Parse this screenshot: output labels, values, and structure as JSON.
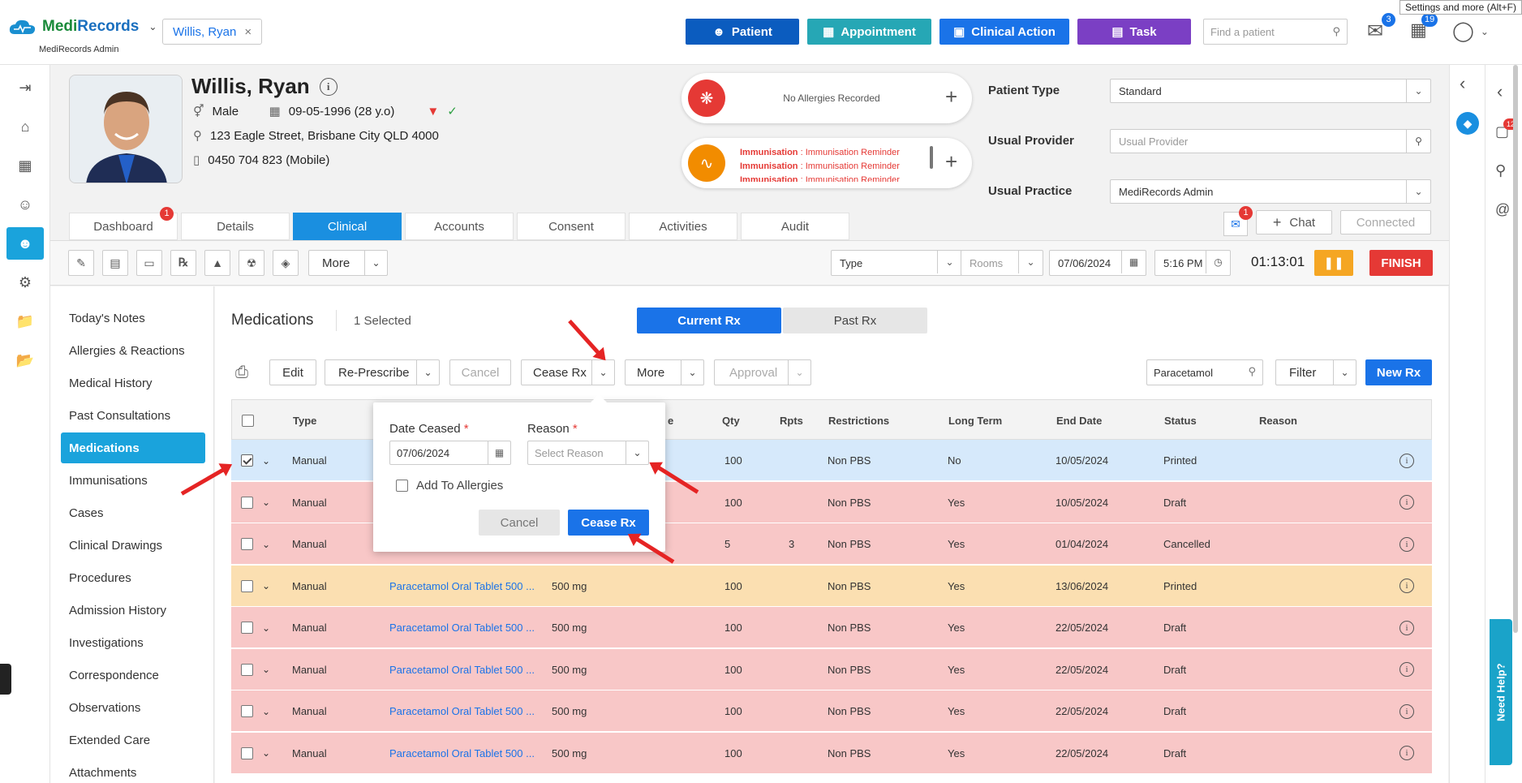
{
  "app": {
    "logo_name_part1": "Medi",
    "logo_name_part2": "Records",
    "logo_sub": "MediRecords Admin",
    "tooltip": "Settings and more (Alt+F)"
  },
  "topbar": {
    "patient_chip": "Willis, Ryan",
    "buttons": {
      "patient": "Patient",
      "appointment": "Appointment",
      "clinical_action": "Clinical Action",
      "task": "Task"
    },
    "find_placeholder": "Find a patient",
    "mail_count": "3",
    "tasks_count": "19",
    "colors": {
      "patient": "#0b5cbf",
      "appointment": "#26a7b5",
      "clinical_action": "#1a73e8",
      "task": "#7b3fc4"
    }
  },
  "patient": {
    "name": "Willis, Ryan",
    "sex": "Male",
    "dob": "09-05-1996 (28 y.o)",
    "address": "123 Eagle Street, Brisbane City QLD 4000",
    "phone": "0450 704 823 (Mobile)"
  },
  "alerts": {
    "allergies": "No Allergies Recorded",
    "immunisations": [
      {
        "label": "Immunisation",
        "value": "Immunisation Reminder"
      },
      {
        "label": "Immunisation",
        "value": "Immunisation Reminder"
      },
      {
        "label": "Immunisation",
        "value": "Immunisation Reminder"
      }
    ]
  },
  "patient_fields": {
    "type_label": "Patient Type",
    "type_value": "Standard",
    "provider_label": "Usual Provider",
    "provider_placeholder": "Usual Provider",
    "practice_label": "Usual Practice",
    "practice_value": "MediRecords Admin"
  },
  "chat": {
    "chat_label": "Chat",
    "connected_label": "Connected",
    "message_badge": "1"
  },
  "tabs": [
    {
      "label": "Dashboard",
      "badge": "1"
    },
    {
      "label": "Details"
    },
    {
      "label": "Clinical"
    },
    {
      "label": "Accounts"
    },
    {
      "label": "Consent"
    },
    {
      "label": "Activities"
    },
    {
      "label": "Audit"
    }
  ],
  "toolbar": {
    "more_label": "More",
    "type_placeholder": "Type",
    "rooms_placeholder": "Rooms",
    "date": "07/06/2024",
    "time": "5:16 PM",
    "timer": "01:13:01",
    "finish_label": "FINISH"
  },
  "sidenav": [
    "Today's Notes",
    "Allergies & Reactions",
    "Medical History",
    "Past Consultations",
    "Medications",
    "Immunisations",
    "Cases",
    "Clinical Drawings",
    "Procedures",
    "Admission History",
    "Investigations",
    "Correspondence",
    "Observations",
    "Extended Care",
    "Attachments"
  ],
  "medications": {
    "title": "Medications",
    "selected": "1 Selected",
    "current_tab": "Current Rx",
    "past_tab": "Past Rx",
    "actions": {
      "edit": "Edit",
      "represcribe": "Re-Prescribe",
      "cancel": "Cancel",
      "cease": "Cease Rx",
      "more": "More",
      "approval": "Approval",
      "filter": "Filter",
      "new_rx": "New Rx"
    },
    "search_value": "Paracetamol",
    "columns": {
      "type": "Type",
      "dose_partial": "e",
      "qty": "Qty",
      "rpts": "Rpts",
      "restrictions": "Restrictions",
      "long_term": "Long Term",
      "end_date": "End Date",
      "status": "Status",
      "reason": "Reason"
    },
    "rows": [
      {
        "type": "Manual",
        "drug": "",
        "dose": "",
        "qty": "100",
        "rpts": "",
        "restrictions": "Non PBS",
        "long_term": "No",
        "end_date": "10/05/2024",
        "status": "Printed",
        "checked": true,
        "color": "#d6e9fb"
      },
      {
        "type": "Manual",
        "drug": "",
        "dose": "",
        "qty": "100",
        "rpts": "",
        "restrictions": "Non PBS",
        "long_term": "Yes",
        "end_date": "10/05/2024",
        "status": "Draft",
        "checked": false,
        "color": "#f8c7c7"
      },
      {
        "type": "Manual",
        "drug": "",
        "dose": "",
        "qty": "5",
        "rpts": "3",
        "restrictions": "Non PBS",
        "long_term": "Yes",
        "end_date": "01/04/2024",
        "status": "Cancelled",
        "checked": false,
        "color": "#f8c7c7"
      },
      {
        "type": "Manual",
        "drug": "Paracetamol Oral Tablet 500 ...",
        "dose": "500 mg",
        "qty": "100",
        "rpts": "",
        "restrictions": "Non PBS",
        "long_term": "Yes",
        "end_date": "13/06/2024",
        "status": "Printed",
        "checked": false,
        "color": "#fbdfb1"
      },
      {
        "type": "Manual",
        "drug": "Paracetamol Oral Tablet 500 ...",
        "dose": "500 mg",
        "qty": "100",
        "rpts": "",
        "restrictions": "Non PBS",
        "long_term": "Yes",
        "end_date": "22/05/2024",
        "status": "Draft",
        "checked": false,
        "color": "#f8c7c7"
      },
      {
        "type": "Manual",
        "drug": "Paracetamol Oral Tablet 500 ...",
        "dose": "500 mg",
        "qty": "100",
        "rpts": "",
        "restrictions": "Non PBS",
        "long_term": "Yes",
        "end_date": "22/05/2024",
        "status": "Draft",
        "checked": false,
        "color": "#f8c7c7"
      },
      {
        "type": "Manual",
        "drug": "Paracetamol Oral Tablet 500 ...",
        "dose": "500 mg",
        "qty": "100",
        "rpts": "",
        "restrictions": "Non PBS",
        "long_term": "Yes",
        "end_date": "22/05/2024",
        "status": "Draft",
        "checked": false,
        "color": "#f8c7c7"
      },
      {
        "type": "Manual",
        "drug": "Paracetamol Oral Tablet 500 ...",
        "dose": "500 mg",
        "qty": "100",
        "rpts": "",
        "restrictions": "Non PBS",
        "long_term": "Yes",
        "end_date": "22/05/2024",
        "status": "Draft",
        "checked": false,
        "color": "#f8c7c7"
      }
    ]
  },
  "cease_popover": {
    "date_label": "Date Ceased",
    "date_value": "07/06/2024",
    "reason_label": "Reason",
    "reason_placeholder": "Select Reason",
    "add_allergies_label": "Add To Allergies",
    "cancel_label": "Cancel",
    "cease_label": "Cease Rx"
  },
  "right_panel": {
    "chat_badge": "12",
    "help_label": "Need Help?"
  }
}
